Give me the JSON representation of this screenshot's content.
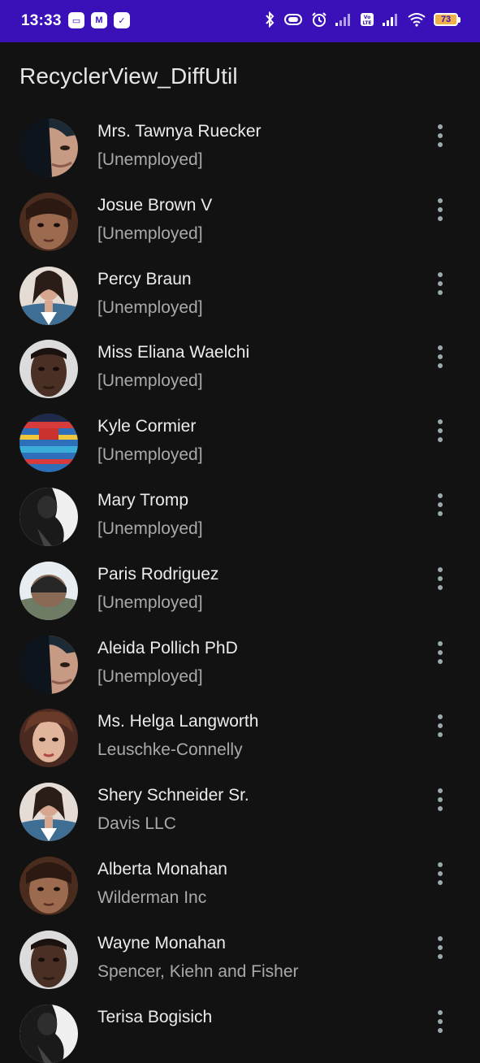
{
  "status_bar": {
    "time": "13:33",
    "left_icons": [
      "messaging-app-icon",
      "gmail-icon",
      "check-app-icon"
    ],
    "right_icons": [
      "bluetooth-icon",
      "vibrate-icon",
      "alarm-icon",
      "signal-icon",
      "volte-icon",
      "signal-icon",
      "wifi-icon",
      "battery-icon"
    ],
    "battery_level": "73",
    "background": "#3a11b8"
  },
  "app_bar": {
    "title": "RecyclerView_DiffUtil"
  },
  "contacts": [
    {
      "name": "Mrs. Tawnya Ruecker",
      "company": "[Unemployed]",
      "avatar": "man-half-shadow"
    },
    {
      "name": "Josue Brown V",
      "company": "[Unemployed]",
      "avatar": "child-portrait"
    },
    {
      "name": "Percy Braun",
      "company": "[Unemployed]",
      "avatar": "woman-denim"
    },
    {
      "name": "Miss Eliana Waelchi",
      "company": "[Unemployed]",
      "avatar": "man-portrait"
    },
    {
      "name": "Kyle Cormier",
      "company": "[Unemployed]",
      "avatar": "colorful-sweater"
    },
    {
      "name": "Mary Tromp",
      "company": "[Unemployed]",
      "avatar": "dark-silhouette"
    },
    {
      "name": "Paris Rodriguez",
      "company": "[Unemployed]",
      "avatar": "beanie-back"
    },
    {
      "name": "Aleida Pollich PhD",
      "company": "[Unemployed]",
      "avatar": "man-half-shadow"
    },
    {
      "name": "Ms. Helga Langworth",
      "company": "Leuschke-Connelly",
      "avatar": "woman-curly"
    },
    {
      "name": "Shery Schneider Sr.",
      "company": "Davis LLC",
      "avatar": "woman-denim"
    },
    {
      "name": "Alberta Monahan",
      "company": "Wilderman Inc",
      "avatar": "child-portrait"
    },
    {
      "name": "Wayne Monahan",
      "company": "Spencer, Kiehn and Fisher",
      "avatar": "man-portrait"
    },
    {
      "name": "Terisa Bogisich",
      "company": "",
      "avatar": "dark-silhouette"
    }
  ]
}
